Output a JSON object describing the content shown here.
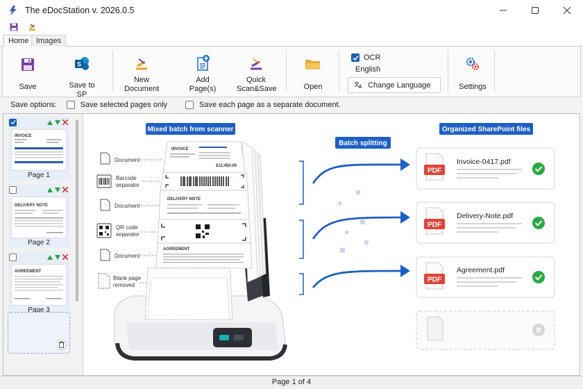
{
  "window": {
    "title": "The eDocStation v. 2026.0.5"
  },
  "tabs": [
    {
      "label": "Home"
    },
    {
      "label": "Images"
    }
  ],
  "ribbon": {
    "save": "Save",
    "save_to_sp": "Save to SP",
    "new_document": "New Document",
    "add_pages": "Add Page(s)",
    "quick_scan_save": "Quick Scan&Save",
    "open": "Open",
    "ocr_label": "OCR",
    "ocr_checked": true,
    "language": "English",
    "change_language": "Change Language",
    "settings": "Settings"
  },
  "save_options": {
    "label": "Save options:",
    "selected_pages_only": "Save selected pages only",
    "separate_document": "Save each page as a separate document."
  },
  "thumbnails": [
    {
      "label": "Page  1",
      "checked": true,
      "heading": "INVOICE"
    },
    {
      "label": "Page  2",
      "checked": false,
      "heading": "DELIVERY NOTE"
    },
    {
      "label": "Page  3",
      "checked": false,
      "heading": "AGREEMENT"
    }
  ],
  "illustration": {
    "left_title": "Mixed batch from scanner",
    "middle_title": "Batch splitting",
    "right_title": "Organized SharePoint files",
    "stack_labels": {
      "document1": "Document",
      "barcode1": "Barcode",
      "barcode2": "separator",
      "document2": "Document",
      "qr1": "QR code",
      "qr2": "separator",
      "document3": "Document",
      "blank1": "Blank page",
      "blank2": "removed"
    },
    "stack_pages": {
      "invoice": "INVOICE",
      "invoice_amount": "$12,450.00",
      "delivery": "DELIVERY NOTE",
      "agreement": "AGREEMENT"
    },
    "files": [
      {
        "name": "Invoice-0417.pdf",
        "badge": "PDF"
      },
      {
        "name": "Delivery-Note.pdf",
        "badge": "PDF"
      },
      {
        "name": "Agreement.pdf",
        "badge": "PDF"
      }
    ]
  },
  "status": {
    "page_info": "Page 1 of 4"
  },
  "colors": {
    "accent": "#1e5fc4",
    "pdf_red": "#e0443a",
    "check_green": "#2aa845",
    "save_purple": "#7b3fa6"
  }
}
